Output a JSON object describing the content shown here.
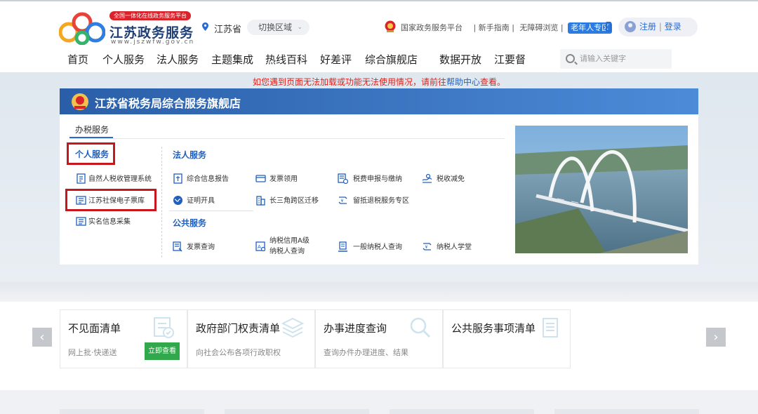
{
  "header": {
    "logo_tag": "全国一体化在线政务服务平台",
    "logo_name": "江苏政务服务",
    "logo_url": "www.jszwfw.gov.cn",
    "location": "江苏省",
    "switch_region": "切换区域",
    "top_links": [
      "国家政务服务平台",
      "| 新手指南 |",
      "无障碍浏览 |"
    ],
    "elder_zone": "老年人专区",
    "register": "注册",
    "login_sep": "|",
    "login": "登录",
    "nav": [
      "首页",
      "个人服务",
      "法人服务",
      "主题集成",
      "热线百科",
      "好差评",
      "综合旗舰店",
      "数据开放",
      "江要督"
    ],
    "search_placeholder": "请输入关键字"
  },
  "notice": {
    "prefix": "如您遇到页面无法加载或功能无法使用情况，请前往",
    "link": "帮助中心",
    "suffix": "查看。"
  },
  "panel": {
    "title": "江苏省税务局综合服务旗舰店",
    "tab": "办税服务",
    "personal": {
      "title": "个人服务",
      "items": [
        "自然人税收管理系统",
        "江苏社保电子票库",
        "实名信息采集"
      ]
    },
    "legal": {
      "title": "法人服务",
      "items": [
        "综合信息报告",
        "发票领用",
        "税费申报与缴纳",
        "税收减免",
        "证明开具",
        "长三角跨区迁移",
        "留抵退税服务专区"
      ]
    },
    "public": {
      "title": "公共服务",
      "items": [
        "发票查询",
        "纳税信用A级",
        "纳税人查询",
        "一般纳税人查询",
        "纳税人学堂"
      ]
    }
  },
  "cards": [
    {
      "title": "不见面清单",
      "sub": "网上批·快递送",
      "button": "立即查看"
    },
    {
      "title": "政府部门权责清单",
      "sub": "向社会公布各项行政职权"
    },
    {
      "title": "办事进度查询",
      "sub": "查询办件办理进度、结果"
    },
    {
      "title": "公共服务事项清单",
      "sub": ""
    }
  ],
  "arrows": {
    "prev": "‹",
    "next": "›"
  },
  "colors": {
    "brand_blue": "#2b6ad0",
    "notice_red": "#e0231c",
    "highlight_red": "#c8161d",
    "go_green": "#31a84b"
  }
}
